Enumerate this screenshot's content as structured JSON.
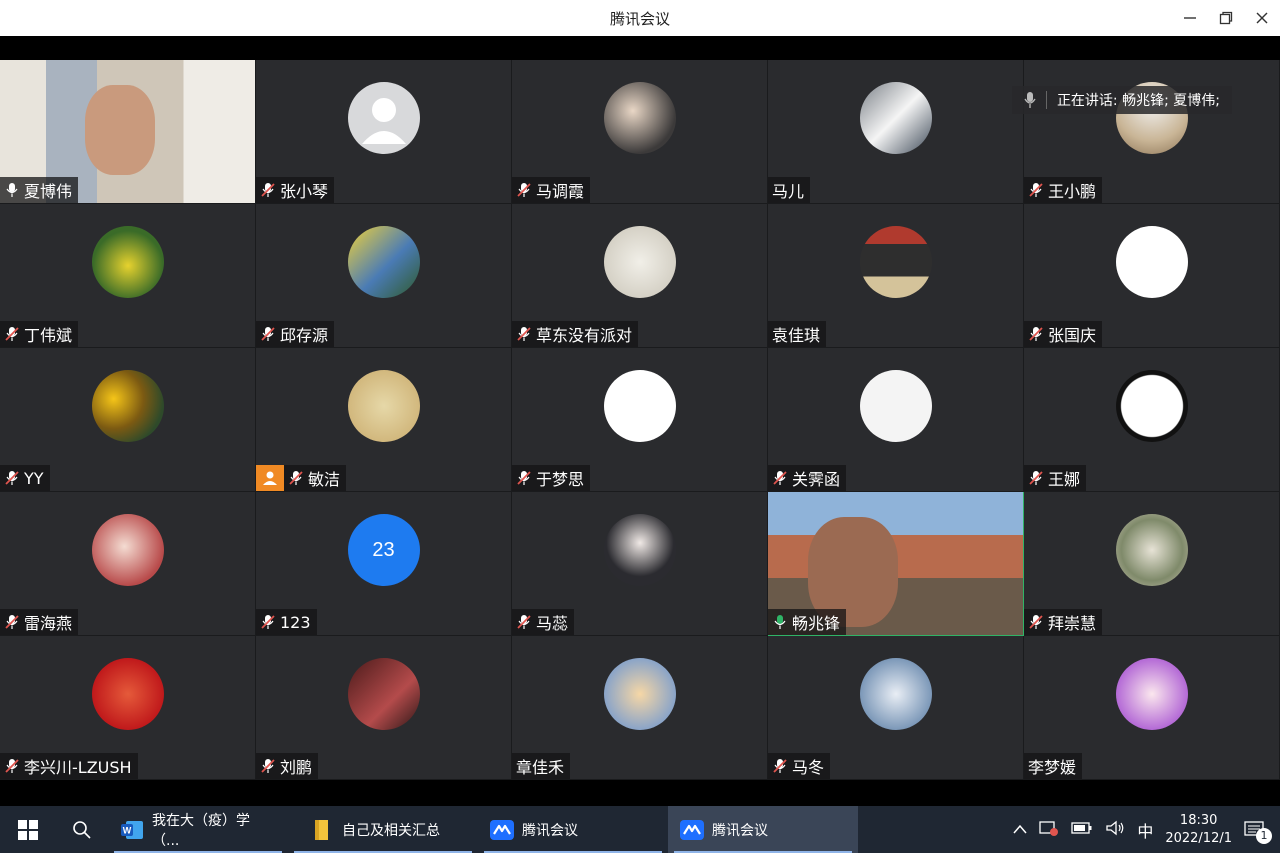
{
  "window": {
    "title": "腾讯会议"
  },
  "speaking": {
    "label": "正在讲话: 畅兆锋; 夏博伟;"
  },
  "participants": [
    {
      "name": "夏博伟",
      "mic": "on",
      "type": "video"
    },
    {
      "name": "张小琴",
      "mic": "off",
      "type": "avatar"
    },
    {
      "name": "马调霞",
      "mic": "off",
      "type": "avatar"
    },
    {
      "name": "马儿",
      "mic": "none",
      "type": "avatar"
    },
    {
      "name": "王小鹏",
      "mic": "off",
      "type": "avatar"
    },
    {
      "name": "丁伟斌",
      "mic": "off",
      "type": "avatar"
    },
    {
      "name": "邱存源",
      "mic": "off",
      "type": "avatar"
    },
    {
      "name": "草东没有派对",
      "mic": "off",
      "type": "avatar"
    },
    {
      "name": "袁佳琪",
      "mic": "none",
      "type": "avatar"
    },
    {
      "name": "张国庆",
      "mic": "off",
      "type": "avatar"
    },
    {
      "name": "YY",
      "mic": "off",
      "type": "avatar"
    },
    {
      "name": "敏洁",
      "mic": "off",
      "type": "avatar",
      "host": true
    },
    {
      "name": "于梦思",
      "mic": "off",
      "type": "avatar"
    },
    {
      "name": "关霁函",
      "mic": "off",
      "type": "avatar"
    },
    {
      "name": "王娜",
      "mic": "off",
      "type": "avatar"
    },
    {
      "name": "雷海燕",
      "mic": "off",
      "type": "avatar"
    },
    {
      "name": "123",
      "mic": "off",
      "type": "number",
      "avatar_text": "23"
    },
    {
      "name": "马蕊",
      "mic": "off",
      "type": "avatar"
    },
    {
      "name": "畅兆锋",
      "mic": "active",
      "type": "video"
    },
    {
      "name": "拜崇慧",
      "mic": "off",
      "type": "avatar"
    },
    {
      "name": "李兴川-LZUSH",
      "mic": "off",
      "type": "avatar"
    },
    {
      "name": "刘鹏",
      "mic": "off",
      "type": "avatar"
    },
    {
      "name": "章佳禾",
      "mic": "none",
      "type": "avatar"
    },
    {
      "name": "马冬",
      "mic": "off",
      "type": "avatar"
    },
    {
      "name": "李梦媛",
      "mic": "none",
      "type": "avatar"
    }
  ],
  "taskbar": {
    "items": [
      {
        "label": "我在大（疫）学（..."
      },
      {
        "label": "自己及相关汇总"
      },
      {
        "label": "腾讯会议"
      },
      {
        "label": "腾讯会议"
      }
    ],
    "ime": "中",
    "time": "18:30",
    "date": "2022/12/1",
    "notification_count": "1"
  },
  "colors": {
    "accent_green": "#2fb466",
    "mic_off_red": "#e0554f",
    "number_avatar_blue": "#1e7bf0",
    "host_orange": "#f08a24",
    "taskbar": "#1f2733"
  }
}
